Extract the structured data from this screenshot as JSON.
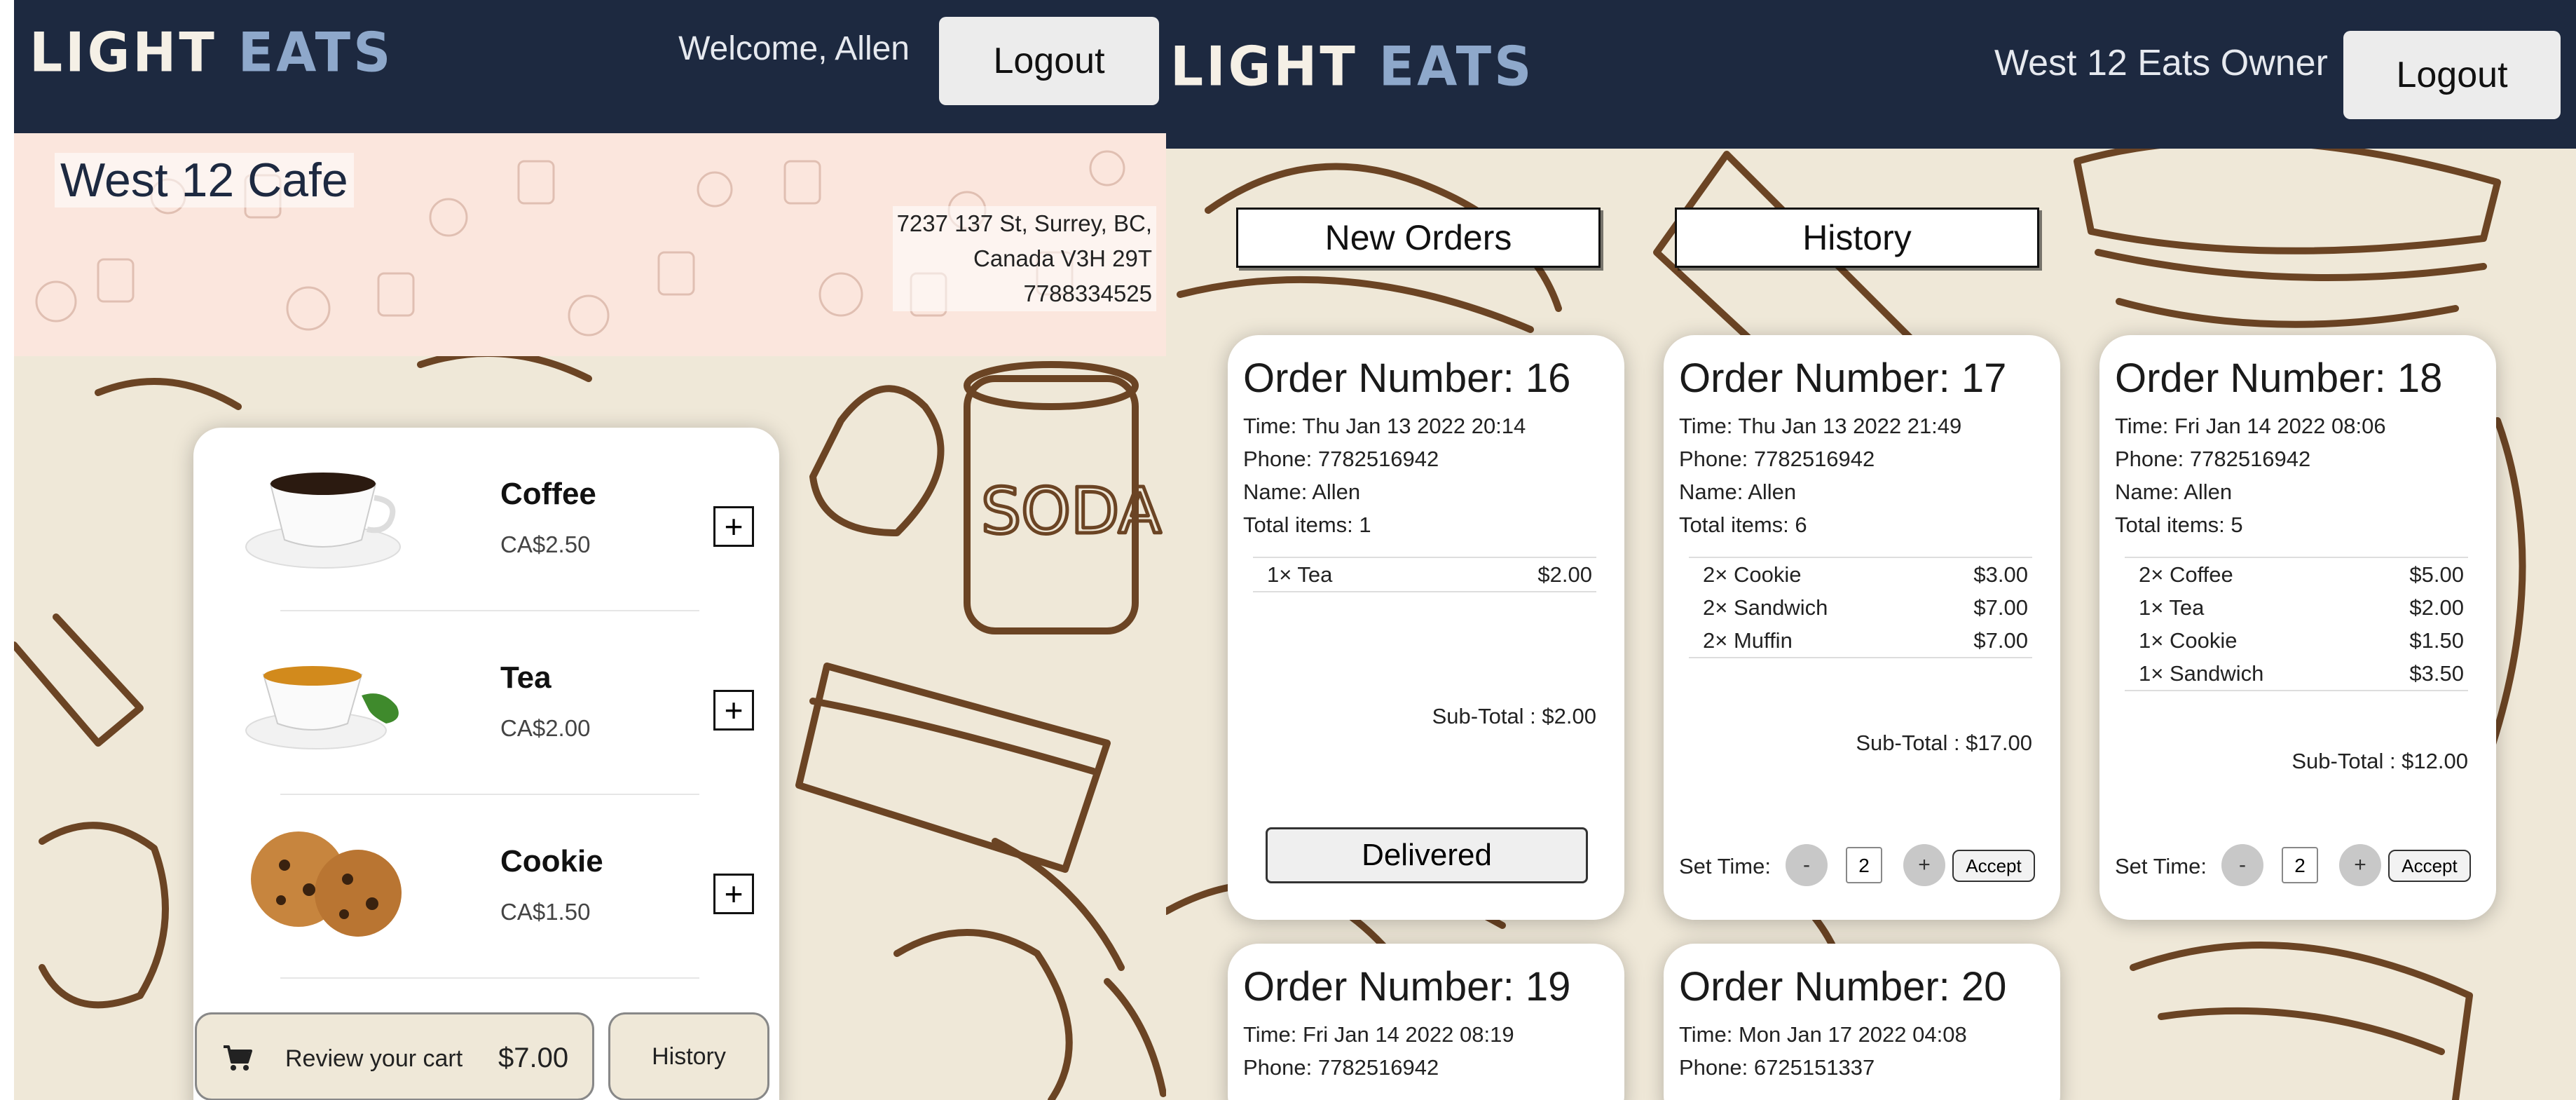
{
  "customer_view": {
    "header": {
      "logo_word1": "LIGHT",
      "logo_word2": "EATS",
      "welcome": "Welcome, Allen",
      "logout_label": "Logout"
    },
    "cafe": {
      "name": "West 12 Cafe",
      "address_line1": "7237 137 St, Surrey, BC,",
      "address_line2": "Canada V3H 29T",
      "phone": "7788334525"
    },
    "menu": [
      {
        "name": "Coffee",
        "price": "CA$2.50",
        "add_label": "+",
        "icon": "coffee-cup-icon"
      },
      {
        "name": "Tea",
        "price": "CA$2.00",
        "add_label": "+",
        "icon": "tea-cup-icon"
      },
      {
        "name": "Cookie",
        "price": "CA$1.50",
        "add_label": "+",
        "icon": "cookie-icon"
      }
    ],
    "cart": {
      "label": "Review your cart",
      "total": "$7.00",
      "icon": "cart-icon"
    },
    "history_label": "History"
  },
  "owner_view": {
    "header": {
      "logo_word1": "LIGHT",
      "logo_word2": "EATS",
      "owner_name": "West 12 Eats Owner",
      "logout_label": "Logout"
    },
    "tabs": {
      "new_orders": "New Orders",
      "history": "History"
    },
    "orders": [
      {
        "title": "Order Number: 16",
        "time": "Time: Thu Jan 13 2022 20:14",
        "phone": "Phone: 7782516942",
        "name": "Name: Allen",
        "total_items": "Total items: 1",
        "items": [
          {
            "qty": "1× Tea",
            "price": "$2.00"
          }
        ],
        "subtotal": "Sub-Total : $2.00",
        "action": "Delivered"
      },
      {
        "title": "Order Number: 17",
        "time": "Time: Thu Jan 13 2022 21:49",
        "phone": "Phone: 7782516942",
        "name": "Name: Allen",
        "total_items": "Total items: 6",
        "items": [
          {
            "qty": "2× Cookie",
            "price": "$3.00"
          },
          {
            "qty": "2× Sandwich",
            "price": "$7.00"
          },
          {
            "qty": "2× Muffin",
            "price": "$7.00"
          }
        ],
        "subtotal": "Sub-Total : $17.00",
        "set_time_label": "Set Time:",
        "minus": "-",
        "plus": "+",
        "time_value": "2",
        "accept": "Accept"
      },
      {
        "title": "Order Number: 18",
        "time": "Time: Fri Jan 14 2022 08:06",
        "phone": "Phone: 7782516942",
        "name": "Name: Allen",
        "total_items": "Total items: 5",
        "items": [
          {
            "qty": "2× Coffee",
            "price": "$5.00"
          },
          {
            "qty": "1× Tea",
            "price": "$2.00"
          },
          {
            "qty": "1× Cookie",
            "price": "$1.50"
          },
          {
            "qty": "1× Sandwich",
            "price": "$3.50"
          }
        ],
        "subtotal": "Sub-Total : $12.00",
        "set_time_label": "Set Time:",
        "minus": "-",
        "plus": "+",
        "time_value": "2",
        "accept": "Accept"
      },
      {
        "title": "Order Number: 19",
        "time": "Time: Fri Jan 14 2022 08:19",
        "phone": "Phone: 7782516942"
      },
      {
        "title": "Order Number: 20",
        "time": "Time: Mon Jan 17 2022 04:08",
        "phone": "Phone: 6725151337"
      }
    ]
  },
  "colors": {
    "header_bg": "#1d2940",
    "logo_accent": "#8ea8cb",
    "page_bg": "#efe8d8",
    "doodle_stroke": "#6b4424",
    "banner_bg": "#fbe6dd"
  }
}
